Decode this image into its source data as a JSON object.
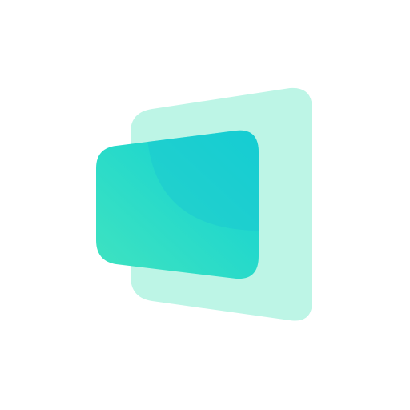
{
  "icon": {
    "name": "layered-cards-icon",
    "colors": {
      "background": "#ffffff",
      "back_card": "#bdf5e6",
      "front_card_start": "#40e3c0",
      "front_card_end": "#0fd1d4",
      "front_card_overlay": "#1cc8d2"
    }
  }
}
